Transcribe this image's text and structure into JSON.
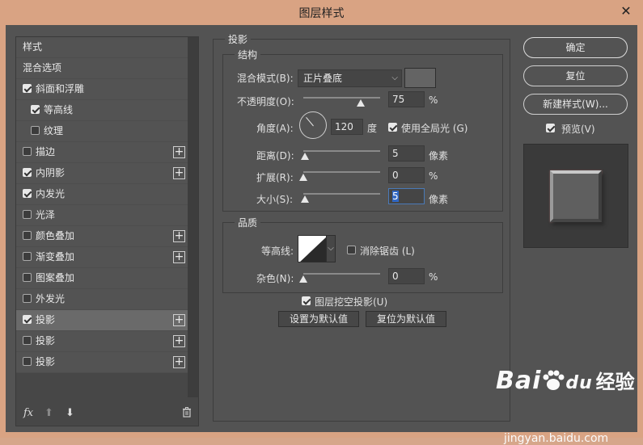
{
  "window": {
    "title": "图层样式",
    "close_glyph": "✕"
  },
  "list": {
    "items": [
      {
        "label": "样式",
        "checkbox": false,
        "checked": false,
        "plus": false,
        "indent": 0
      },
      {
        "label": "混合选项",
        "checkbox": false,
        "checked": false,
        "plus": false,
        "indent": 0
      },
      {
        "label": "斜面和浮雕",
        "checkbox": true,
        "checked": true,
        "plus": false,
        "indent": 0
      },
      {
        "label": "等高线",
        "checkbox": true,
        "checked": true,
        "plus": false,
        "indent": 1
      },
      {
        "label": "纹理",
        "checkbox": true,
        "checked": false,
        "plus": false,
        "indent": 1
      },
      {
        "label": "描边",
        "checkbox": true,
        "checked": false,
        "plus": true,
        "indent": 0
      },
      {
        "label": "内阴影",
        "checkbox": true,
        "checked": true,
        "plus": true,
        "indent": 0
      },
      {
        "label": "内发光",
        "checkbox": true,
        "checked": true,
        "plus": false,
        "indent": 0
      },
      {
        "label": "光泽",
        "checkbox": true,
        "checked": false,
        "plus": false,
        "indent": 0
      },
      {
        "label": "颜色叠加",
        "checkbox": true,
        "checked": false,
        "plus": true,
        "indent": 0
      },
      {
        "label": "渐变叠加",
        "checkbox": true,
        "checked": false,
        "plus": true,
        "indent": 0
      },
      {
        "label": "图案叠加",
        "checkbox": true,
        "checked": false,
        "plus": false,
        "indent": 0
      },
      {
        "label": "外发光",
        "checkbox": true,
        "checked": false,
        "plus": false,
        "indent": 0
      },
      {
        "label": "投影",
        "checkbox": true,
        "checked": true,
        "plus": true,
        "indent": 0,
        "selected": true
      },
      {
        "label": "投影",
        "checkbox": true,
        "checked": false,
        "plus": true,
        "indent": 0
      },
      {
        "label": "投影",
        "checkbox": true,
        "checked": false,
        "plus": true,
        "indent": 0
      }
    ],
    "bottom": {
      "fx": "fx",
      "up": "⬆",
      "down": "⬇",
      "trash": "🗑"
    }
  },
  "drop_shadow": {
    "section_title": "投影",
    "structure": {
      "title": "结构",
      "blend_mode_label": "混合模式(B):",
      "blend_mode_value": "正片叠底",
      "shadow_color": "#646464",
      "opacity_label": "不透明度(O):",
      "opacity_value": "75",
      "opacity_unit": "%",
      "angle_label": "角度(A):",
      "angle_value": "120",
      "angle_unit": "度",
      "global_light_label": "使用全局光 (G)",
      "distance_label": "距离(D):",
      "distance_value": "5",
      "distance_unit": "像素",
      "spread_label": "扩展(R):",
      "spread_value": "0",
      "spread_unit": "%",
      "size_label": "大小(S):",
      "size_value": "5",
      "size_unit": "像素",
      "opacity_level": 0.75,
      "distance_level": 0.02,
      "spread_level": 0.0,
      "size_level": 0.02
    },
    "quality": {
      "title": "品质",
      "contour_label": "等高线:",
      "antialias_label": "消除锯齿 (L)",
      "noise_label": "杂色(N):",
      "noise_value": "0",
      "noise_unit": "%",
      "noise_level": 0.0
    },
    "knockout_label": "图层挖空投影(U)",
    "set_default_label": "设置为默认值",
    "reset_default_label": "复位为默认值"
  },
  "right": {
    "ok_label": "确定",
    "reset_label": "复位",
    "new_style_label": "新建样式(W)...",
    "preview_label": "预览(V)"
  },
  "watermark": {
    "brand": "Bai",
    "brand2": "du",
    "cn": "经验",
    "url": "jingyan.baidu.com"
  }
}
